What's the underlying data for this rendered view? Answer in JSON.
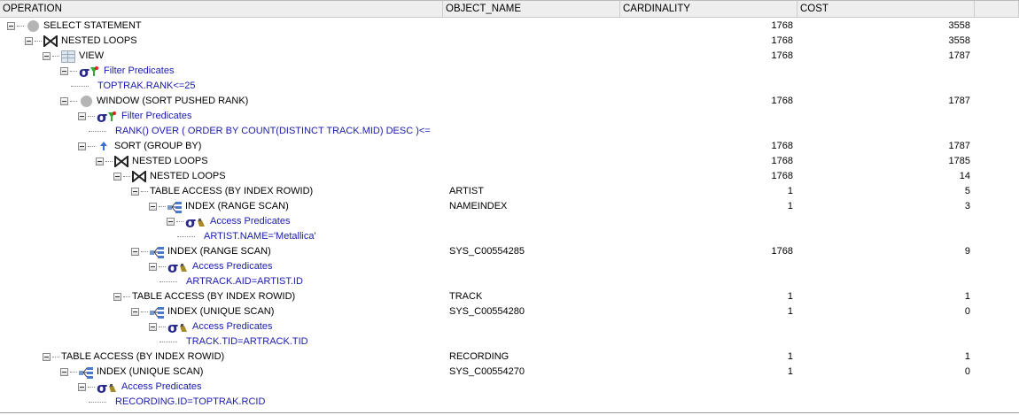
{
  "columns": [
    "OPERATION",
    "OBJECT_NAME",
    "CARDINALITY",
    "COST"
  ],
  "rows": [
    {
      "level": 0,
      "icon": "circle-icon",
      "op": "SELECT STATEMENT",
      "obj": "",
      "card": "1768",
      "cost": "3558",
      "exp": true
    },
    {
      "level": 1,
      "icon": "nested-loops-icon",
      "op": "NESTED LOOPS",
      "obj": "",
      "card": "1768",
      "cost": "3558",
      "exp": true
    },
    {
      "level": 2,
      "icon": "view-icon",
      "op": "VIEW",
      "obj": "",
      "card": "1768",
      "cost": "1787",
      "exp": true
    },
    {
      "level": 3,
      "icon": "filter-icon",
      "op": "Filter Predicates",
      "obj": "",
      "card": "",
      "cost": "",
      "exp": true,
      "pred": true
    },
    {
      "level": 4,
      "icon": "",
      "op": "TOPTRAK.RANK<=25",
      "obj": "",
      "card": "",
      "cost": "",
      "pred": true,
      "leaf": true
    },
    {
      "level": 3,
      "icon": "circle-icon",
      "op": "WINDOW (SORT PUSHED RANK)",
      "obj": "",
      "card": "1768",
      "cost": "1787",
      "exp": true
    },
    {
      "level": 4,
      "icon": "filter-icon",
      "op": "Filter Predicates",
      "obj": "",
      "card": "",
      "cost": "",
      "exp": true,
      "pred": true
    },
    {
      "level": 5,
      "icon": "",
      "op": "RANK() OVER ( ORDER BY COUNT(DISTINCT TRACK.MID) DESC )<=",
      "obj": "",
      "card": "",
      "cost": "",
      "pred": true,
      "leaf": true
    },
    {
      "level": 4,
      "icon": "sort-icon",
      "op": "SORT (GROUP BY)",
      "obj": "",
      "card": "1768",
      "cost": "1787",
      "exp": true
    },
    {
      "level": 5,
      "icon": "nested-loops-icon",
      "op": "NESTED LOOPS",
      "obj": "",
      "card": "1768",
      "cost": "1785",
      "exp": true
    },
    {
      "level": 6,
      "icon": "nested-loops-icon",
      "op": "NESTED LOOPS",
      "obj": "",
      "card": "1768",
      "cost": "14",
      "exp": true
    },
    {
      "level": 7,
      "icon": "",
      "op": "TABLE ACCESS (BY INDEX ROWID)",
      "obj": "ARTIST",
      "card": "1",
      "cost": "5",
      "exp": true
    },
    {
      "level": 8,
      "icon": "index-icon",
      "op": "INDEX (RANGE SCAN)",
      "obj": "NAMEINDEX",
      "card": "1",
      "cost": "3",
      "exp": true
    },
    {
      "level": 9,
      "icon": "access-icon",
      "op": "Access Predicates",
      "obj": "",
      "card": "",
      "cost": "",
      "exp": true,
      "pred": true
    },
    {
      "level": 10,
      "icon": "",
      "op": "ARTIST.NAME='Metallica'",
      "obj": "",
      "card": "",
      "cost": "",
      "pred": true,
      "leaf": true
    },
    {
      "level": 7,
      "icon": "index-icon",
      "op": "INDEX (RANGE SCAN)",
      "obj": "SYS_C00554285",
      "card": "1768",
      "cost": "9",
      "exp": true
    },
    {
      "level": 8,
      "icon": "access-icon",
      "op": "Access Predicates",
      "obj": "",
      "card": "",
      "cost": "",
      "exp": true,
      "pred": true
    },
    {
      "level": 9,
      "icon": "",
      "op": "ARTRACK.AID=ARTIST.ID",
      "obj": "",
      "card": "",
      "cost": "",
      "pred": true,
      "leaf": true
    },
    {
      "level": 6,
      "icon": "",
      "op": "TABLE ACCESS (BY INDEX ROWID)",
      "obj": "TRACK",
      "card": "1",
      "cost": "1",
      "exp": true
    },
    {
      "level": 7,
      "icon": "index-icon",
      "op": "INDEX (UNIQUE SCAN)",
      "obj": "SYS_C00554280",
      "card": "1",
      "cost": "0",
      "exp": true
    },
    {
      "level": 8,
      "icon": "access-icon",
      "op": "Access Predicates",
      "obj": "",
      "card": "",
      "cost": "",
      "exp": true,
      "pred": true
    },
    {
      "level": 9,
      "icon": "",
      "op": "TRACK.TID=ARTRACK.TID",
      "obj": "",
      "card": "",
      "cost": "",
      "pred": true,
      "leaf": true
    },
    {
      "level": 2,
      "icon": "",
      "op": "TABLE ACCESS (BY INDEX ROWID)",
      "obj": "RECORDING",
      "card": "1",
      "cost": "1",
      "exp": true
    },
    {
      "level": 3,
      "icon": "index-icon",
      "op": "INDEX (UNIQUE SCAN)",
      "obj": "SYS_C00554270",
      "card": "1",
      "cost": "0",
      "exp": true
    },
    {
      "level": 4,
      "icon": "access-icon",
      "op": "Access Predicates",
      "obj": "",
      "card": "",
      "cost": "",
      "exp": true,
      "pred": true
    },
    {
      "level": 5,
      "icon": "",
      "op": "RECORDING.ID=TOPTRAK.RCID",
      "obj": "",
      "card": "",
      "cost": "",
      "pred": true,
      "leaf": true
    }
  ]
}
